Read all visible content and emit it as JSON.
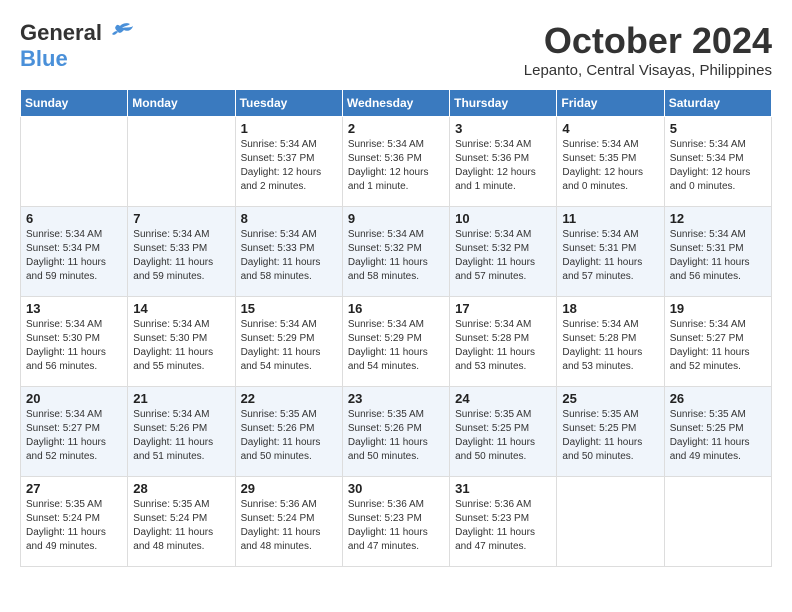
{
  "logo": {
    "general": "General",
    "blue": "Blue"
  },
  "title": "October 2024",
  "location": "Lepanto, Central Visayas, Philippines",
  "days_of_week": [
    "Sunday",
    "Monday",
    "Tuesday",
    "Wednesday",
    "Thursday",
    "Friday",
    "Saturday"
  ],
  "weeks": [
    [
      {
        "day": "",
        "sunrise": "",
        "sunset": "",
        "daylight": ""
      },
      {
        "day": "",
        "sunrise": "",
        "sunset": "",
        "daylight": ""
      },
      {
        "day": "1",
        "sunrise": "Sunrise: 5:34 AM",
        "sunset": "Sunset: 5:37 PM",
        "daylight": "Daylight: 12 hours and 2 minutes."
      },
      {
        "day": "2",
        "sunrise": "Sunrise: 5:34 AM",
        "sunset": "Sunset: 5:36 PM",
        "daylight": "Daylight: 12 hours and 1 minute."
      },
      {
        "day": "3",
        "sunrise": "Sunrise: 5:34 AM",
        "sunset": "Sunset: 5:36 PM",
        "daylight": "Daylight: 12 hours and 1 minute."
      },
      {
        "day": "4",
        "sunrise": "Sunrise: 5:34 AM",
        "sunset": "Sunset: 5:35 PM",
        "daylight": "Daylight: 12 hours and 0 minutes."
      },
      {
        "day": "5",
        "sunrise": "Sunrise: 5:34 AM",
        "sunset": "Sunset: 5:34 PM",
        "daylight": "Daylight: 12 hours and 0 minutes."
      }
    ],
    [
      {
        "day": "6",
        "sunrise": "Sunrise: 5:34 AM",
        "sunset": "Sunset: 5:34 PM",
        "daylight": "Daylight: 11 hours and 59 minutes."
      },
      {
        "day": "7",
        "sunrise": "Sunrise: 5:34 AM",
        "sunset": "Sunset: 5:33 PM",
        "daylight": "Daylight: 11 hours and 59 minutes."
      },
      {
        "day": "8",
        "sunrise": "Sunrise: 5:34 AM",
        "sunset": "Sunset: 5:33 PM",
        "daylight": "Daylight: 11 hours and 58 minutes."
      },
      {
        "day": "9",
        "sunrise": "Sunrise: 5:34 AM",
        "sunset": "Sunset: 5:32 PM",
        "daylight": "Daylight: 11 hours and 58 minutes."
      },
      {
        "day": "10",
        "sunrise": "Sunrise: 5:34 AM",
        "sunset": "Sunset: 5:32 PM",
        "daylight": "Daylight: 11 hours and 57 minutes."
      },
      {
        "day": "11",
        "sunrise": "Sunrise: 5:34 AM",
        "sunset": "Sunset: 5:31 PM",
        "daylight": "Daylight: 11 hours and 57 minutes."
      },
      {
        "day": "12",
        "sunrise": "Sunrise: 5:34 AM",
        "sunset": "Sunset: 5:31 PM",
        "daylight": "Daylight: 11 hours and 56 minutes."
      }
    ],
    [
      {
        "day": "13",
        "sunrise": "Sunrise: 5:34 AM",
        "sunset": "Sunset: 5:30 PM",
        "daylight": "Daylight: 11 hours and 56 minutes."
      },
      {
        "day": "14",
        "sunrise": "Sunrise: 5:34 AM",
        "sunset": "Sunset: 5:30 PM",
        "daylight": "Daylight: 11 hours and 55 minutes."
      },
      {
        "day": "15",
        "sunrise": "Sunrise: 5:34 AM",
        "sunset": "Sunset: 5:29 PM",
        "daylight": "Daylight: 11 hours and 54 minutes."
      },
      {
        "day": "16",
        "sunrise": "Sunrise: 5:34 AM",
        "sunset": "Sunset: 5:29 PM",
        "daylight": "Daylight: 11 hours and 54 minutes."
      },
      {
        "day": "17",
        "sunrise": "Sunrise: 5:34 AM",
        "sunset": "Sunset: 5:28 PM",
        "daylight": "Daylight: 11 hours and 53 minutes."
      },
      {
        "day": "18",
        "sunrise": "Sunrise: 5:34 AM",
        "sunset": "Sunset: 5:28 PM",
        "daylight": "Daylight: 11 hours and 53 minutes."
      },
      {
        "day": "19",
        "sunrise": "Sunrise: 5:34 AM",
        "sunset": "Sunset: 5:27 PM",
        "daylight": "Daylight: 11 hours and 52 minutes."
      }
    ],
    [
      {
        "day": "20",
        "sunrise": "Sunrise: 5:34 AM",
        "sunset": "Sunset: 5:27 PM",
        "daylight": "Daylight: 11 hours and 52 minutes."
      },
      {
        "day": "21",
        "sunrise": "Sunrise: 5:34 AM",
        "sunset": "Sunset: 5:26 PM",
        "daylight": "Daylight: 11 hours and 51 minutes."
      },
      {
        "day": "22",
        "sunrise": "Sunrise: 5:35 AM",
        "sunset": "Sunset: 5:26 PM",
        "daylight": "Daylight: 11 hours and 50 minutes."
      },
      {
        "day": "23",
        "sunrise": "Sunrise: 5:35 AM",
        "sunset": "Sunset: 5:26 PM",
        "daylight": "Daylight: 11 hours and 50 minutes."
      },
      {
        "day": "24",
        "sunrise": "Sunrise: 5:35 AM",
        "sunset": "Sunset: 5:25 PM",
        "daylight": "Daylight: 11 hours and 50 minutes."
      },
      {
        "day": "25",
        "sunrise": "Sunrise: 5:35 AM",
        "sunset": "Sunset: 5:25 PM",
        "daylight": "Daylight: 11 hours and 50 minutes."
      },
      {
        "day": "26",
        "sunrise": "Sunrise: 5:35 AM",
        "sunset": "Sunset: 5:25 PM",
        "daylight": "Daylight: 11 hours and 49 minutes."
      }
    ],
    [
      {
        "day": "27",
        "sunrise": "Sunrise: 5:35 AM",
        "sunset": "Sunset: 5:24 PM",
        "daylight": "Daylight: 11 hours and 49 minutes."
      },
      {
        "day": "28",
        "sunrise": "Sunrise: 5:35 AM",
        "sunset": "Sunset: 5:24 PM",
        "daylight": "Daylight: 11 hours and 48 minutes."
      },
      {
        "day": "29",
        "sunrise": "Sunrise: 5:36 AM",
        "sunset": "Sunset: 5:24 PM",
        "daylight": "Daylight: 11 hours and 48 minutes."
      },
      {
        "day": "30",
        "sunrise": "Sunrise: 5:36 AM",
        "sunset": "Sunset: 5:23 PM",
        "daylight": "Daylight: 11 hours and 47 minutes."
      },
      {
        "day": "31",
        "sunrise": "Sunrise: 5:36 AM",
        "sunset": "Sunset: 5:23 PM",
        "daylight": "Daylight: 11 hours and 47 minutes."
      },
      {
        "day": "",
        "sunrise": "",
        "sunset": "",
        "daylight": ""
      },
      {
        "day": "",
        "sunrise": "",
        "sunset": "",
        "daylight": ""
      }
    ]
  ]
}
